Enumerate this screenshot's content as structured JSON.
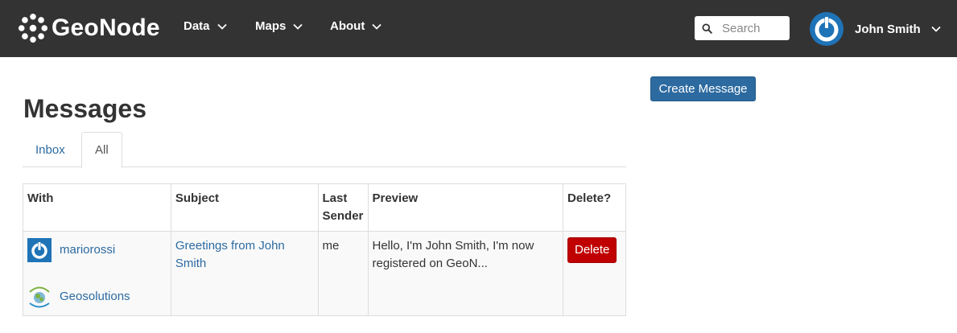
{
  "brand": {
    "name": "GeoNode"
  },
  "nav": {
    "data_label": "Data",
    "maps_label": "Maps",
    "about_label": "About"
  },
  "search": {
    "placeholder": "Search",
    "value": ""
  },
  "user": {
    "name": "John Smith"
  },
  "page": {
    "title": "Messages",
    "create_label": "Create Message"
  },
  "tabs": [
    {
      "label": "Inbox",
      "active": false
    },
    {
      "label": "All",
      "active": true
    }
  ],
  "table": {
    "headers": {
      "with": "With",
      "subject": "Subject",
      "last_sender": "Last Sender",
      "preview": "Preview",
      "delete": "Delete?"
    },
    "rows": [
      {
        "participants": [
          {
            "name": "mariorossi",
            "avatar": "power-avatar-icon"
          },
          {
            "name": "Geosolutions",
            "avatar": "geosolutions-logo-icon"
          }
        ],
        "subject": "Greetings from John Smith",
        "last_sender": "me",
        "preview": "Hello, I'm John Smith, I'm now registered on GeoN...",
        "delete_label": "Delete"
      }
    ]
  },
  "colors": {
    "navbar_bg": "#333333",
    "link": "#2c6aa0",
    "primary_button": "#2c6aa0",
    "danger_button": "#c00000",
    "avatar_blue": "#1f73b7"
  }
}
